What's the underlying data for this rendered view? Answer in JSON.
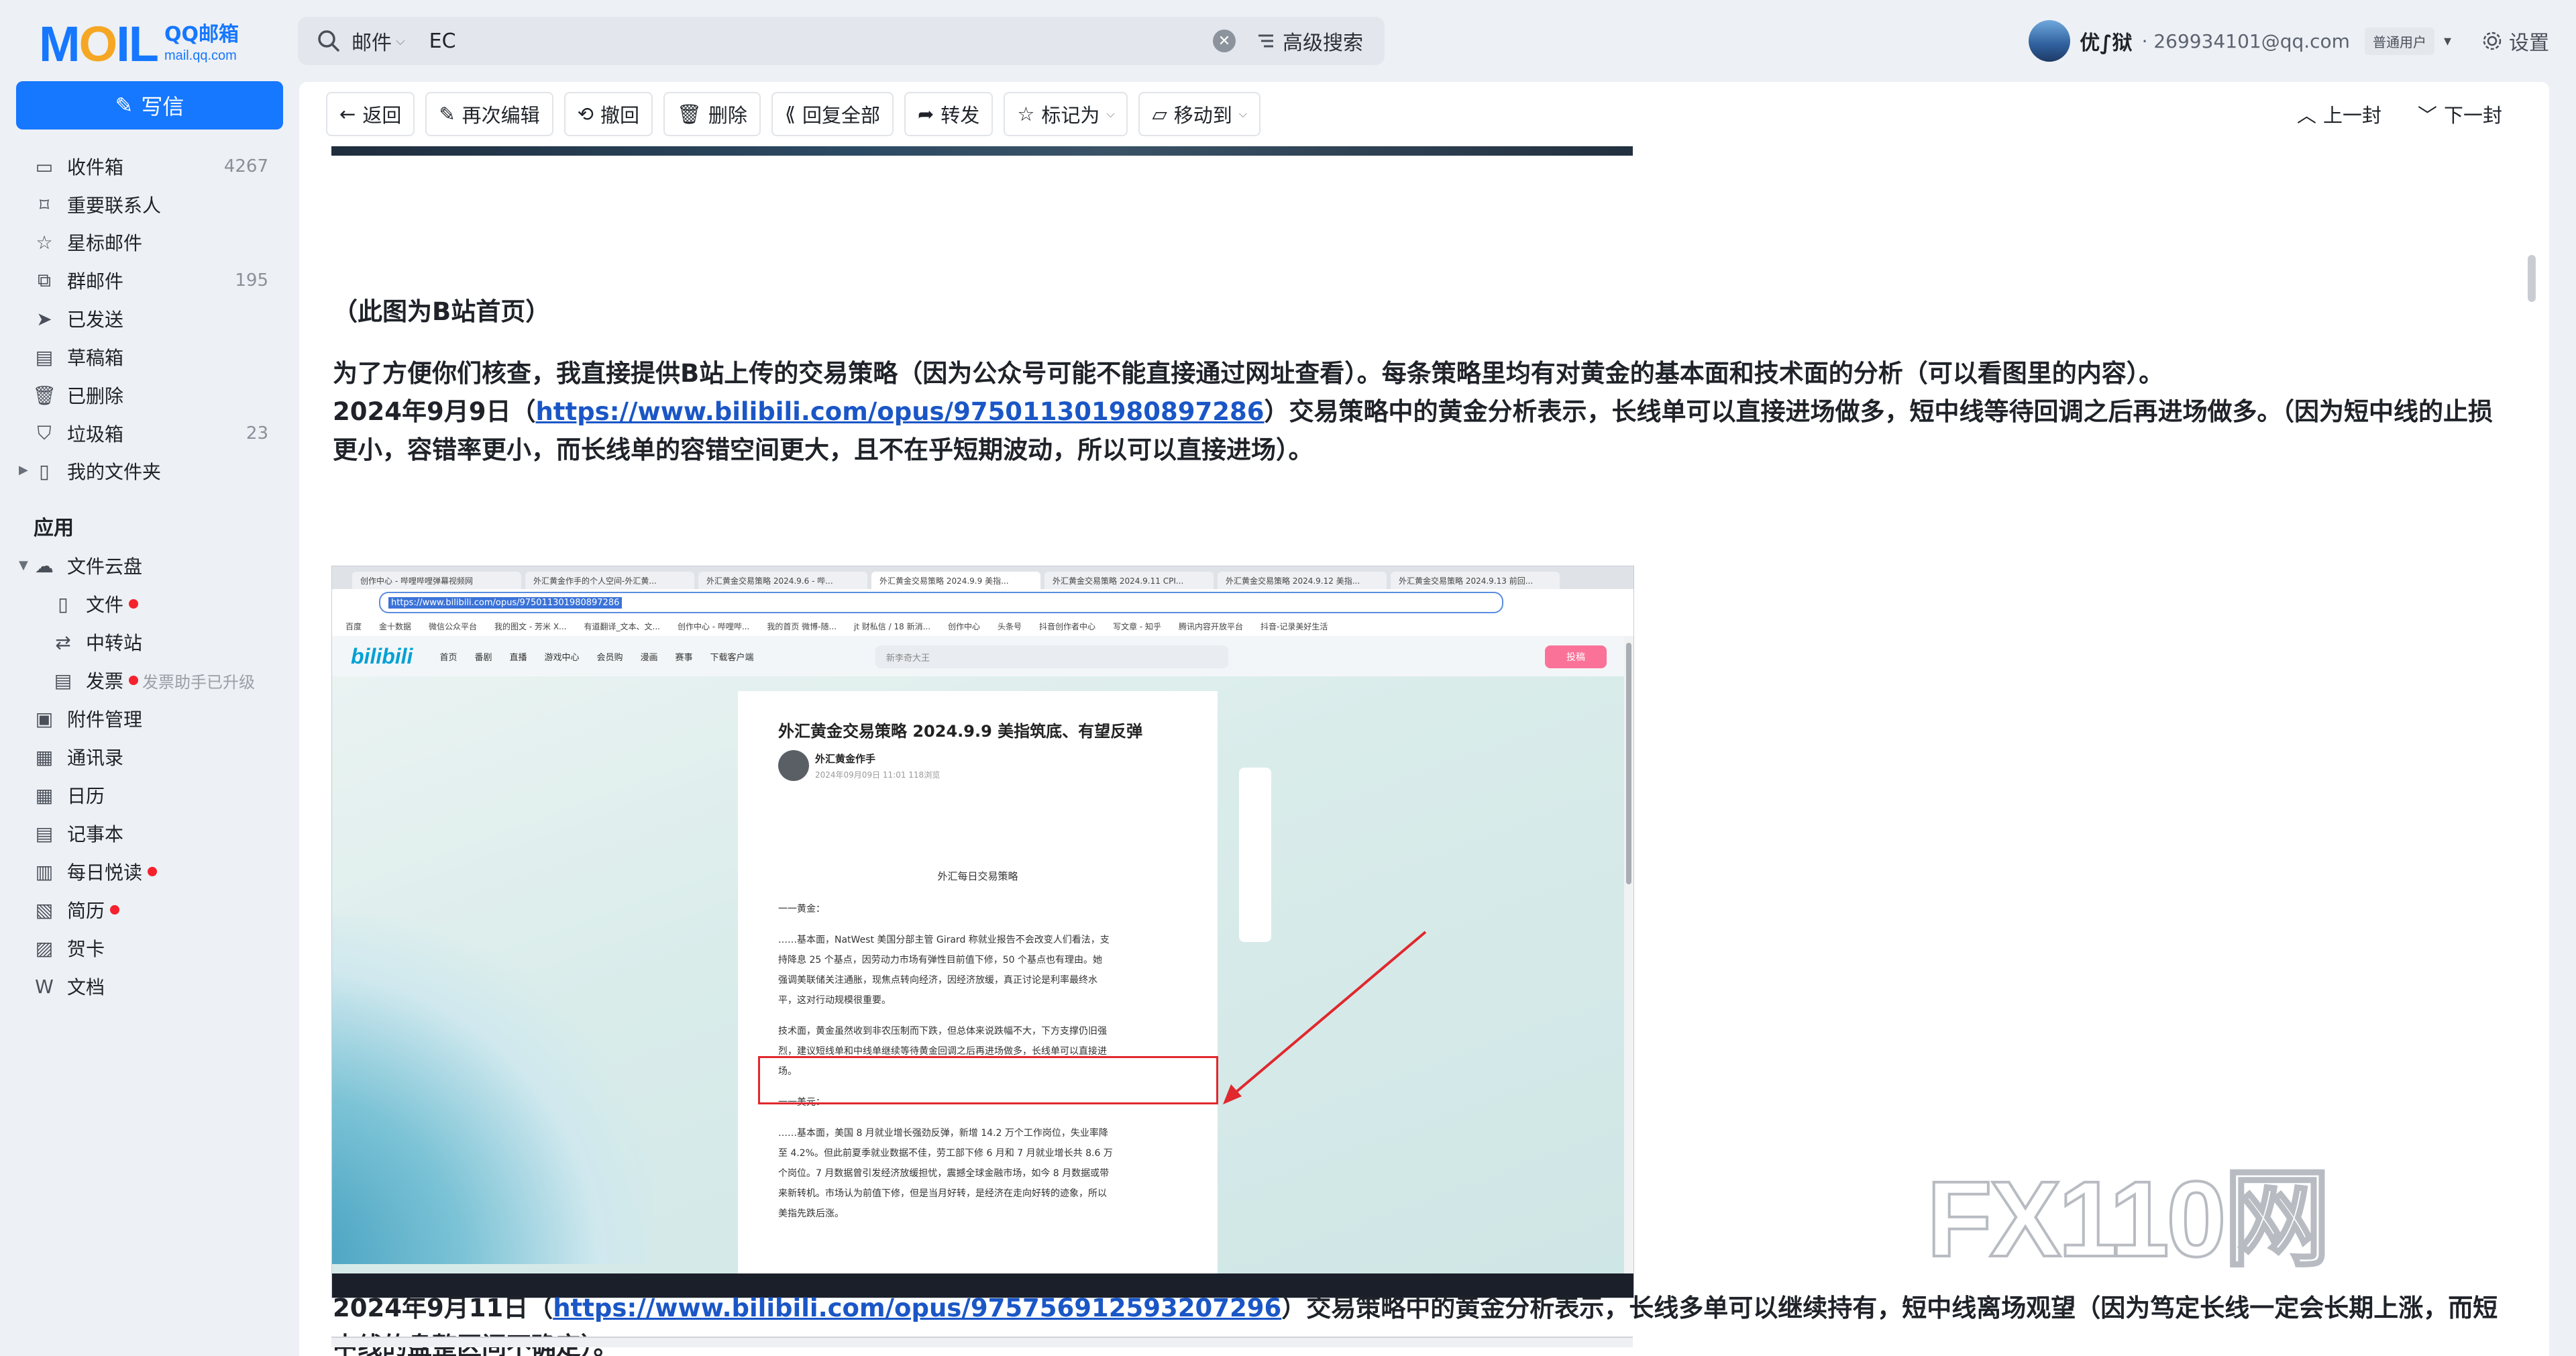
{
  "logo": {
    "word": "MAIL",
    "brand": "QQ邮箱",
    "domain": "mail.qq.com"
  },
  "search": {
    "scope": "邮件",
    "query": "EC",
    "advanced": "高级搜索"
  },
  "account": {
    "name": "优∫狱",
    "email": "· 269934101@qq.com",
    "tier": "普通用户",
    "settings": "设置"
  },
  "compose": "写信",
  "folders": [
    {
      "label": "收件箱",
      "count": "4267",
      "icon": "inbox-icon"
    },
    {
      "label": "重要联系人",
      "count": "",
      "icon": "bookmark-icon"
    },
    {
      "label": "星标邮件",
      "count": "",
      "icon": "star-icon"
    },
    {
      "label": "群邮件",
      "count": "195",
      "icon": "group-icon"
    },
    {
      "label": "已发送",
      "count": "",
      "icon": "send-icon"
    },
    {
      "label": "草稿箱",
      "count": "",
      "icon": "draft-icon"
    },
    {
      "label": "已删除",
      "count": "",
      "icon": "trash-icon"
    },
    {
      "label": "垃圾箱",
      "count": "23",
      "icon": "shield-icon"
    },
    {
      "label": "我的文件夹",
      "count": "",
      "icon": "folder-icon"
    }
  ],
  "apps_title": "应用",
  "apps": {
    "cloud": "文件云盘",
    "files": "文件",
    "transfer": "中转站",
    "invoice": "发票",
    "invoice_hint": "发票助手已升级",
    "attachments": "附件管理",
    "contacts": "通讯录",
    "calendar": "日历",
    "notes": "记事本",
    "reading": "每日悦读",
    "resume": "简历",
    "cards": "贺卡",
    "docs": "文档"
  },
  "toolbar": {
    "back": "返回",
    "reedit": "再次编辑",
    "recall": "撤回",
    "delete": "删除",
    "reply_all": "回复全部",
    "forward": "转发",
    "mark_as": "标记为",
    "move_to": "移动到",
    "prev": "上一封",
    "next": "下一封"
  },
  "body": {
    "caption": "（此图为B站首页）",
    "intro": "为了方便你们核查，我直接提供B站上传的交易策略（因为公众号可能不能直接通过网址查看）。每条策略里均有对黄金的基本面和技术面的分析（可以看图里的内容）。",
    "p1_date": "2024年9月9日（",
    "p1_link": "https://www.bilibili.com/opus/975011301980897286",
    "p1_rest_line1": "）交易策略中的黄金分析表示，长线单可以直接进场做多，短中线等待回调之后再进场做多。（因为短中线的止损",
    "p1_rest_line2": "更小，容错率更小，而长线单的容错空间更大，且不在乎短期波动，所以可以直接进场）。",
    "p2_date": "2024年9月11日（",
    "p2_link": "https://www.bilibili.com/opus/975756912593207296",
    "p2_rest_line1": "）交易策略中的黄金分析表示，长线多单可以继续持有，短中线离场观望（因为笃定长线一定会长期上涨，而短",
    "p2_rest_line2": "中线的盘整区间不确定）。"
  },
  "screenshot": {
    "tabs": [
      "创作中心 - 哔哩哔哩弹幕视频网",
      "外汇黄金作手的个人空间-外汇黄...",
      "外汇黄金交易策略 2024.9.6 - 哔...",
      "外汇黄金交易策略 2024.9.9 美指...",
      "外汇黄金交易策略 2024.9.11 CPI...",
      "外汇黄金交易策略 2024.9.12 美指...",
      "外汇黄金交易策略 2024.9.13 前回..."
    ],
    "url": "https://www.bilibili.com/opus/975011301980897286",
    "bookmarks": [
      "百度",
      "金十数据",
      "微信公众平台",
      "我的图文 - 芳米 X...",
      "有道翻译_文本、文...",
      "创作中心 - 哔哩哔...",
      "我的首页 微博-随...",
      "jt 财私信 / 18 新消...",
      "创作中心",
      "头条号",
      "抖音创作者中心",
      "写文章 - 知乎",
      "腾讯内容开放平台",
      "抖音-记录美好生活"
    ],
    "bili_logo": "bilibili",
    "bili_nav": [
      "首页",
      "番剧",
      "直播",
      "游戏中心",
      "会员购",
      "漫画",
      "赛事",
      "下载客户端"
    ],
    "bili_search": "新李奇大王",
    "upload": "投稿",
    "article_title": "外汇黄金交易策略 2024.9.9 美指筑底、有望反弹",
    "author": "外汇黄金作手",
    "meta": "2024年09月09日 11:01 118浏览",
    "subhead": "外汇每日交易策略",
    "lines": [
      "一一黄金：",
      "……基本面，NatWest 美国分部主管 Girard 称就业报告不会改变人们看法，支",
      "持降息 25 个基点，因劳动力市场有弹性目前值下修，50 个基点也有理由。她",
      "强调美联储关注通胀，现焦点转向经济，因经济放缓，真正讨论是利率最终水",
      "平，这对行动规模很重要。",
      "技术面，黄金虽然收到非农压制而下跌，但总体来说跌幅不大，下方支撑仍旧强",
      "烈，建议短线单和中线单继续等待黄金回调之后再进场做多，长线单可以直接进",
      "场。",
      "一一美元：",
      "……基本面，美国 8 月就业增长强劲反弹，新增 14.2 万个工作岗位，失业率降",
      "至 4.2%。但此前夏季就业数据不佳，劳工部下修 6 月和 7 月就业增长共 8.6 万",
      "个岗位。7 月数据曾引发经济放缓担忧，震撼全球金融市场，如今 8 月数据或带",
      "来新转机。市场认为前值下修，但是当月好转，是经济在走向好转的迹象，所以",
      "美指先跌后涨。"
    ]
  },
  "watermark": "FX110网"
}
